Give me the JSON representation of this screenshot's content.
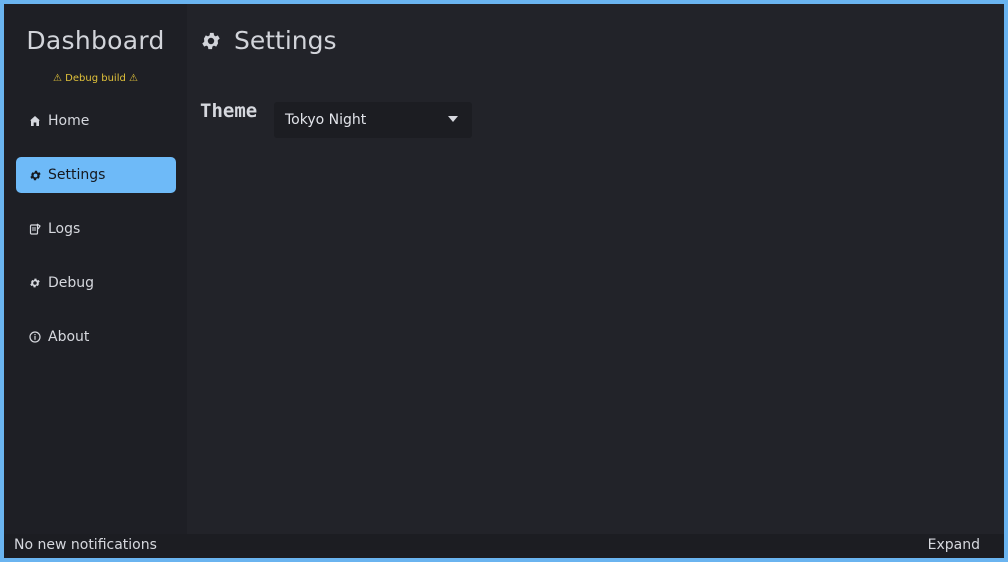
{
  "sidebar": {
    "title": "Dashboard",
    "debug_badge": "⚠ Debug build ⚠",
    "items": [
      {
        "label": "Home",
        "icon": "home-icon",
        "active": false
      },
      {
        "label": "Settings",
        "icon": "gear-icon",
        "active": true
      },
      {
        "label": "Logs",
        "icon": "logs-icon",
        "active": false
      },
      {
        "label": "Debug",
        "icon": "bug-icon",
        "active": false
      },
      {
        "label": "About",
        "icon": "info-icon",
        "active": false
      }
    ]
  },
  "main": {
    "page_title": "Settings",
    "page_icon": "gear-icon",
    "theme_label": "Theme",
    "theme_selected": "Tokyo Night"
  },
  "statusbar": {
    "notification_text": "No new notifications",
    "expand_label": "Expand"
  },
  "colors": {
    "accent": "#6ebaf8",
    "warning": "#e0c13a",
    "sidebar_bg": "#1e1f25",
    "main_bg": "#222329",
    "window_border": "#6ab4f0"
  }
}
